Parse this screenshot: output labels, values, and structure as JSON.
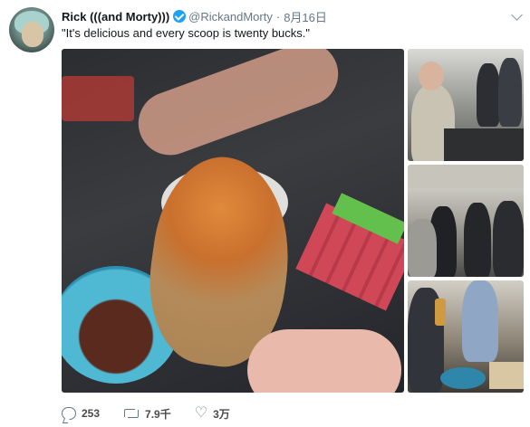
{
  "tweet": {
    "display_name": "Rick (((and Morty)))",
    "handle": "@RickandMorty",
    "separator": "·",
    "date": "8月16日",
    "text": "\"It's delicious and every scoop is twenty bucks.\"",
    "avatar_icon": "rick-avatar-image",
    "verified_icon": "verified-badge-icon",
    "menu_icon": "chevron-down-icon"
  },
  "media": {
    "photos": [
      {
        "name": "photo-nugget-with-sauce"
      },
      {
        "name": "photo-people-tasting"
      },
      {
        "name": "photo-group-standing"
      },
      {
        "name": "photo-pouring-sauce"
      }
    ]
  },
  "actions": {
    "reply_count": "253",
    "retweet_count": "7.9千",
    "like_count": "3万",
    "reply_icon": "reply-icon",
    "retweet_icon": "retweet-icon",
    "like_icon": "heart-icon"
  },
  "colors": {
    "verified": "#1da1f2",
    "secondary_text": "#657786"
  }
}
